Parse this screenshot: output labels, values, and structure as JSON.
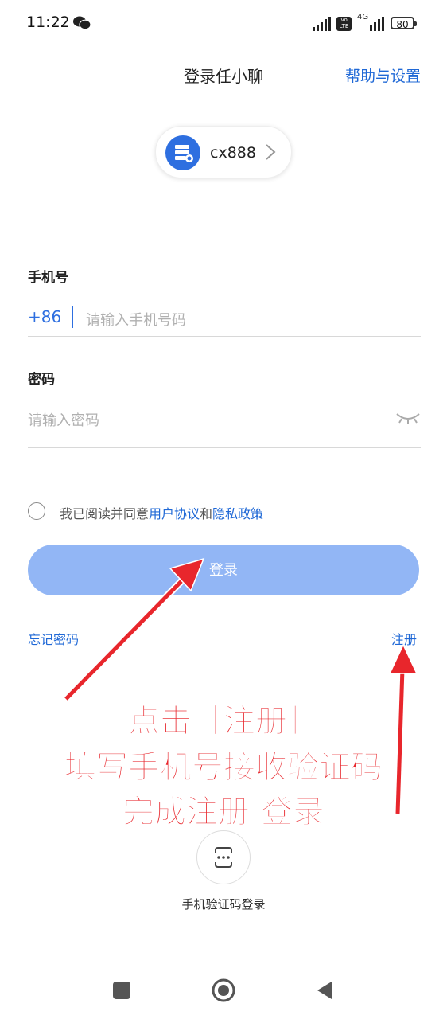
{
  "status_bar": {
    "time": "11:22",
    "volte": "Vo LTE",
    "net": "4G",
    "battery": "80"
  },
  "header": {
    "title": "登录任小聊",
    "help_link": "帮助与设置"
  },
  "server": {
    "name": "cx888"
  },
  "phone": {
    "label": "手机号",
    "country_code": "+86",
    "placeholder": "请输入手机号码"
  },
  "password": {
    "label": "密码",
    "placeholder": "请输入密码"
  },
  "agreement": {
    "prefix": "我已阅读并同意",
    "user_agreement": "用户协议",
    "and": "和",
    "privacy_policy": "隐私政策"
  },
  "actions": {
    "login": "登录",
    "forgot": "忘记密码",
    "register": "注册"
  },
  "annotation": {
    "line1": "点击［注册］",
    "line2": "填写手机号接收验证码",
    "line3": "完成注册 登录"
  },
  "sms_login": {
    "label": "手机验证码登录"
  },
  "colors": {
    "accent": "#1f68d6",
    "button": "#92b6f5",
    "annotation": "#e8262c"
  }
}
